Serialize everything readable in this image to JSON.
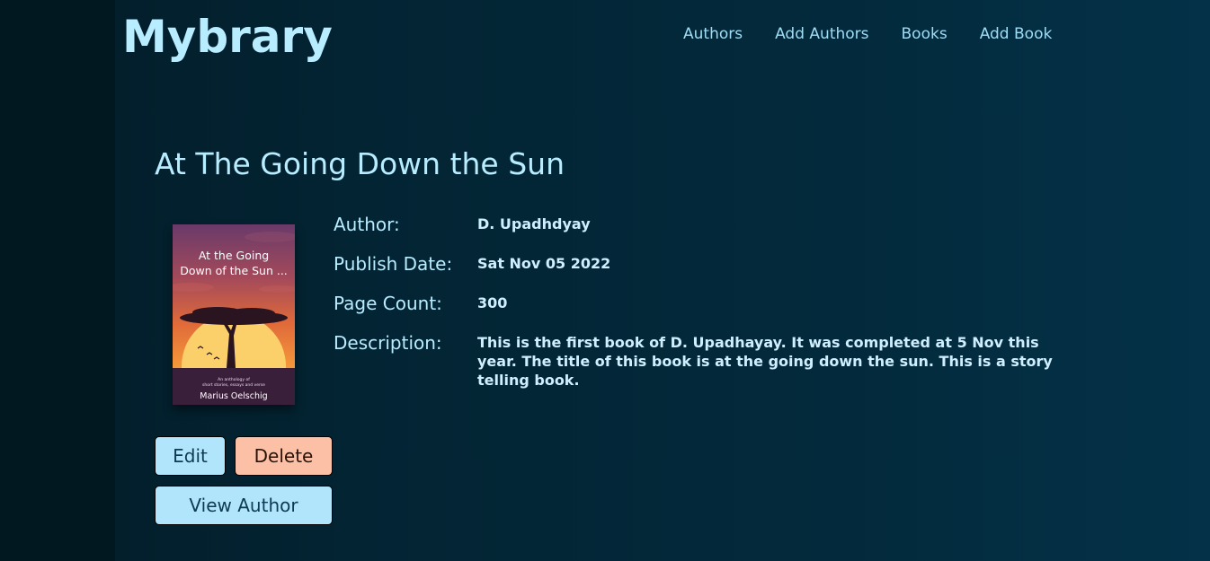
{
  "header": {
    "logo": "Mybrary",
    "nav": [
      "Authors",
      "Add Authors",
      "Books",
      "Add Book"
    ]
  },
  "book": {
    "title": "At The Going Down the Sun",
    "cover": {
      "title_line1": "At the Going",
      "title_line2": "Down of the Sun ...",
      "subtitle_line1": "An anthology of",
      "subtitle_line2": "short stories, essays and verse",
      "author": "Marius Oelschig"
    },
    "details": [
      {
        "label": "Author:",
        "value": "D. Upadhdyay"
      },
      {
        "label": "Publish Date:",
        "value": "Sat Nov 05 2022"
      },
      {
        "label": "Page Count:",
        "value": "300"
      },
      {
        "label": "Description:",
        "value": "This is the first book of D. Upadhayay. It was completed at 5 Nov this year. The title of this book is at the going down the sun. This is a story telling book."
      }
    ]
  },
  "actions": {
    "edit": "Edit",
    "delete": "Delete",
    "view_author": "View Author"
  },
  "colors": {
    "accent": "#b8ecff",
    "edit_button": "#b1e5fb",
    "delete_button": "#fbc0a6"
  }
}
